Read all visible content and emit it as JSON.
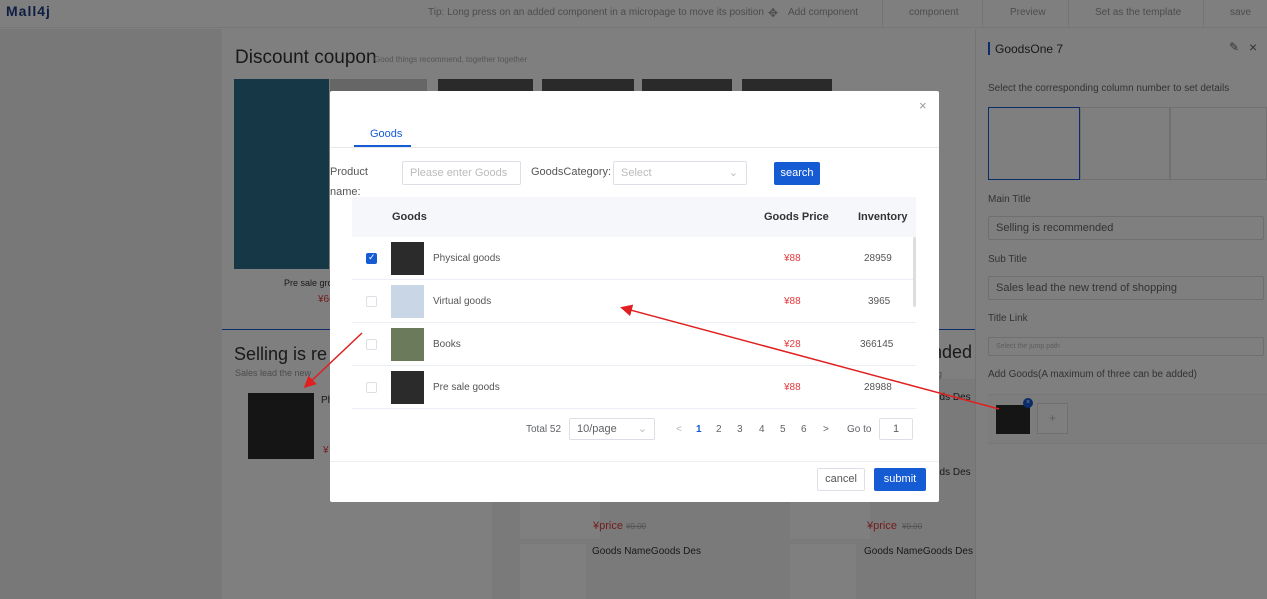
{
  "app": {
    "logo": "Mall4j"
  },
  "topbar": {
    "tip": "Tip: Long press on an added component in a micropage to move its position",
    "add_component": "Add component",
    "component": "component",
    "preview": "Preview",
    "set_template": "Set as the template",
    "save": "save"
  },
  "page": {
    "discount_title": "Discount coupon",
    "discount_sub": "Good things recommend, together together",
    "presale_text": "Pre sale gro",
    "presale_price": "¥66",
    "selling_title": "Selling is re",
    "selling_sub": "Sales lead the new",
    "selling_name": "Ph",
    "selling_price": "¥",
    "nded_text": "nded",
    "g_text": "g",
    "ods_des_1": "ods Des",
    "ods_des_2": "ods Des",
    "price_1": "¥price",
    "old_price_1": "¥0.00",
    "price_2": "¥price",
    "old_price_2": "¥0.00",
    "goods_name_1": "Goods NameGoods Des",
    "goods_name_2": "Goods NameGoods Des"
  },
  "right_panel": {
    "title": "GoodsOne 7",
    "hint": "Select the corresponding column number to set details",
    "main_title_label": "Main Title",
    "main_title_value": "Selling is recommended",
    "sub_title_label": "Sub Title",
    "sub_title_value": "Sales lead the new trend of shopping",
    "title_link_label": "Title Link",
    "title_link_placeholder": "Select the jump path",
    "add_goods_label": "Add Goods(A maximum of three can be added)",
    "add_btn": "+"
  },
  "modal": {
    "tab": "Goods",
    "product_name_label": "Product",
    "product_name_label2": "name:",
    "product_placeholder": "Please enter Goods",
    "category_label": "GoodsCategory:",
    "category_placeholder": "Select",
    "search_label": "search",
    "columns": {
      "goods": "Goods",
      "price": "Goods Price",
      "inventory": "Inventory"
    },
    "rows": [
      {
        "name": "Physical goods",
        "price": "¥88",
        "inventory": "28959",
        "checked": true
      },
      {
        "name": "Virtual goods",
        "price": "¥88",
        "inventory": "3965",
        "checked": false
      },
      {
        "name": "Books",
        "price": "¥28",
        "inventory": "366145",
        "checked": false
      },
      {
        "name": "Pre sale goods",
        "price": "¥88",
        "inventory": "28988",
        "checked": false
      }
    ],
    "pagination": {
      "total": "Total 52",
      "page_size": "10/page",
      "prev": "<",
      "pages": [
        "1",
        "2",
        "3",
        "4",
        "5",
        "6"
      ],
      "next": ">",
      "goto_label": "Go to",
      "goto_value": "1"
    },
    "cancel": "cancel",
    "submit": "submit",
    "close": "×"
  },
  "colors": {
    "accent": "#155bd4",
    "price": "#e4393c",
    "arrow": "#e02020"
  }
}
